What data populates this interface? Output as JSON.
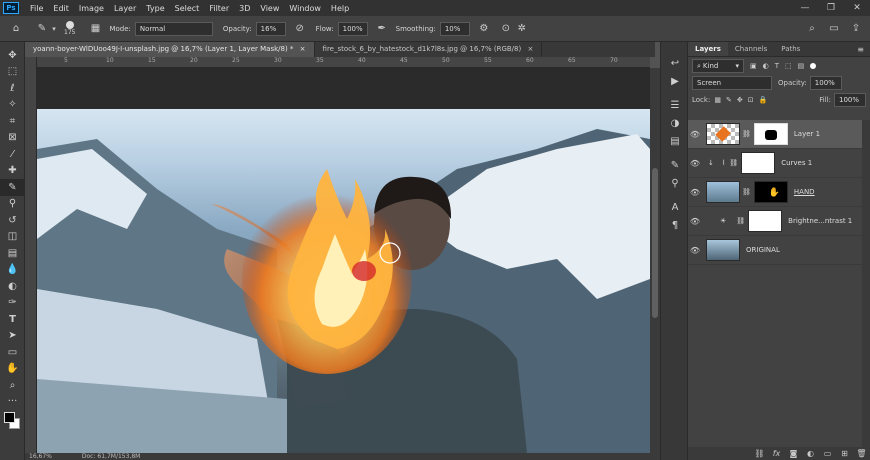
{
  "menu": {
    "logo": "Ps",
    "items": [
      "File",
      "Edit",
      "Image",
      "Layer",
      "Type",
      "Select",
      "Filter",
      "3D",
      "View",
      "Window",
      "Help"
    ]
  },
  "window_controls": [
    "—",
    "❐",
    "✕"
  ],
  "options": {
    "brush_size": "175",
    "mode_label": "Mode:",
    "mode_value": "Normal",
    "opacity_label": "Opacity:",
    "opacity_value": "16%",
    "flow_label": "Flow:",
    "flow_value": "100%",
    "smoothing_label": "Smoothing:",
    "smoothing_value": "10%"
  },
  "tabs": [
    {
      "label": "yoann-boyer-WlDUoo49J-I-unsplash.jpg @ 16,7% (Layer 1, Layer Mask/8) *",
      "close": "×"
    },
    {
      "label": "fire_stock_6_by_hatestock_d1k7l8s.jpg @ 16,7% (RGB/8)",
      "close": "×"
    }
  ],
  "ruler_ticks": [
    "5",
    "10",
    "15",
    "20",
    "25",
    "30",
    "35",
    "40",
    "45",
    "50",
    "55",
    "60",
    "65",
    "70"
  ],
  "status": {
    "zoom": "16,67%",
    "doc": "Doc: 61,7M/153,8M"
  },
  "layers_panel": {
    "tabs": [
      "Layers",
      "Channels",
      "Paths"
    ],
    "kind": "Kind",
    "blend_mode": "Screen",
    "opacity_label": "Opacity:",
    "opacity_value": "100%",
    "lock_label": "Lock:",
    "fill_label": "Fill:",
    "fill_value": "100%",
    "layers": [
      {
        "name": "Layer 1"
      },
      {
        "name": "Curves 1"
      },
      {
        "name": "HAND"
      },
      {
        "name": "Brightne...ntrast 1"
      },
      {
        "name": "ORIGINAL"
      }
    ]
  },
  "colors": {
    "accent": "#31a8ff",
    "fire_core": "#ffd27a",
    "fire_outer": "#e86a1a"
  }
}
